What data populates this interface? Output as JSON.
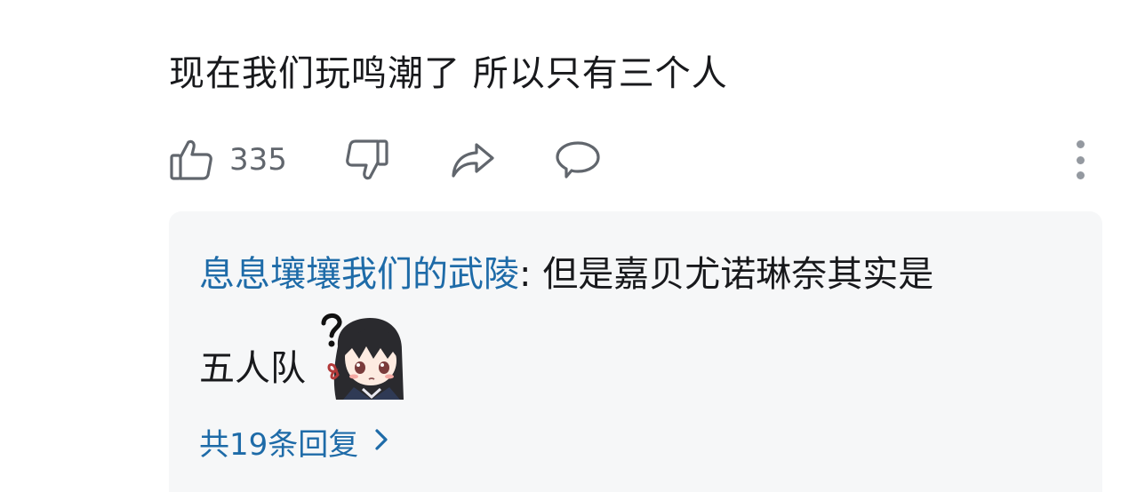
{
  "comment": {
    "text": "现在我们玩鸣潮了 所以只有三个人"
  },
  "actions": {
    "like_count": "335",
    "icons": [
      "thumbs-up-icon",
      "thumbs-down-icon",
      "share-icon",
      "comment-icon",
      "more-vertical-icon"
    ]
  },
  "reply": {
    "username": "息息壤壤我们的武陵",
    "separator": ": ",
    "text_line1": "但是嘉贝尤诺琳奈其实是",
    "text_line2": "五人队",
    "sticker": "confused-girl-sticker",
    "view_all": "共19条回复"
  },
  "colors": {
    "link_blue": "#1e6ba8",
    "text": "#18191c",
    "icon_gray": "#61666d",
    "reply_bg": "#f6f7f8"
  }
}
